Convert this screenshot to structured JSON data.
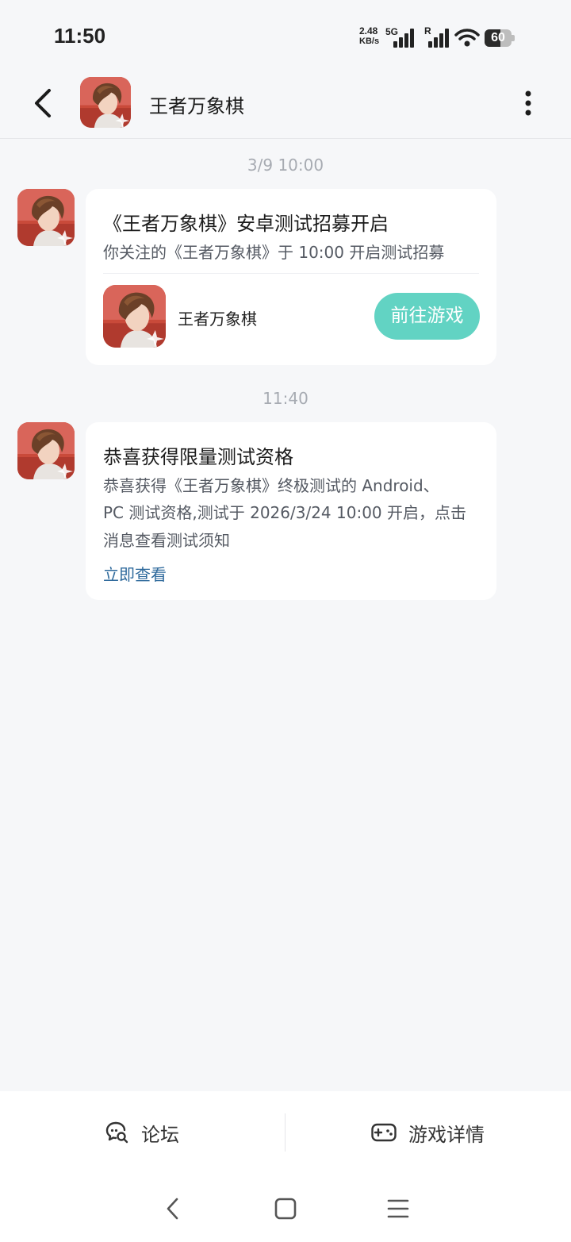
{
  "status_bar": {
    "time": "11:50",
    "net_speed_value": "2.48",
    "net_speed_unit": "KB/s",
    "network_type": "5G",
    "roaming_indicator": "R",
    "battery_level": 60,
    "battery_label": "60"
  },
  "header": {
    "title": "王者万象棋",
    "avatar_icon": "game-app-icon"
  },
  "messages": [
    {
      "timestamp": "3/9  10:00",
      "title": "《王者万象棋》安卓测试招募开启",
      "subtitle": "你关注的《王者万象棋》于 10:00 开启测试招募",
      "game_name": "王者万象棋",
      "button_label": "前往游戏"
    },
    {
      "timestamp": "11:40",
      "title": "恭喜获得限量测试资格",
      "body_lines": [
        "恭喜获得《王者万象棋》终极测试的 Android、",
        "PC 测试资格,测试于 2026/3/24 10:00 开启，点击",
        "消息查看测试须知"
      ],
      "link_label": "立即查看"
    }
  ],
  "bottom_tabs": {
    "forum_label": "论坛",
    "forum_icon": "forum-search-icon",
    "details_label": "游戏详情",
    "details_icon": "gamepad-icon"
  },
  "nav": {
    "back_icon": "nav-back-icon",
    "home_icon": "nav-home-icon",
    "menu_icon": "nav-menu-icon"
  },
  "colors": {
    "background": "#f6f7f9",
    "accent_button": "#62d3c3",
    "link": "#2f6a9c",
    "timestamp": "#a7abb2"
  }
}
